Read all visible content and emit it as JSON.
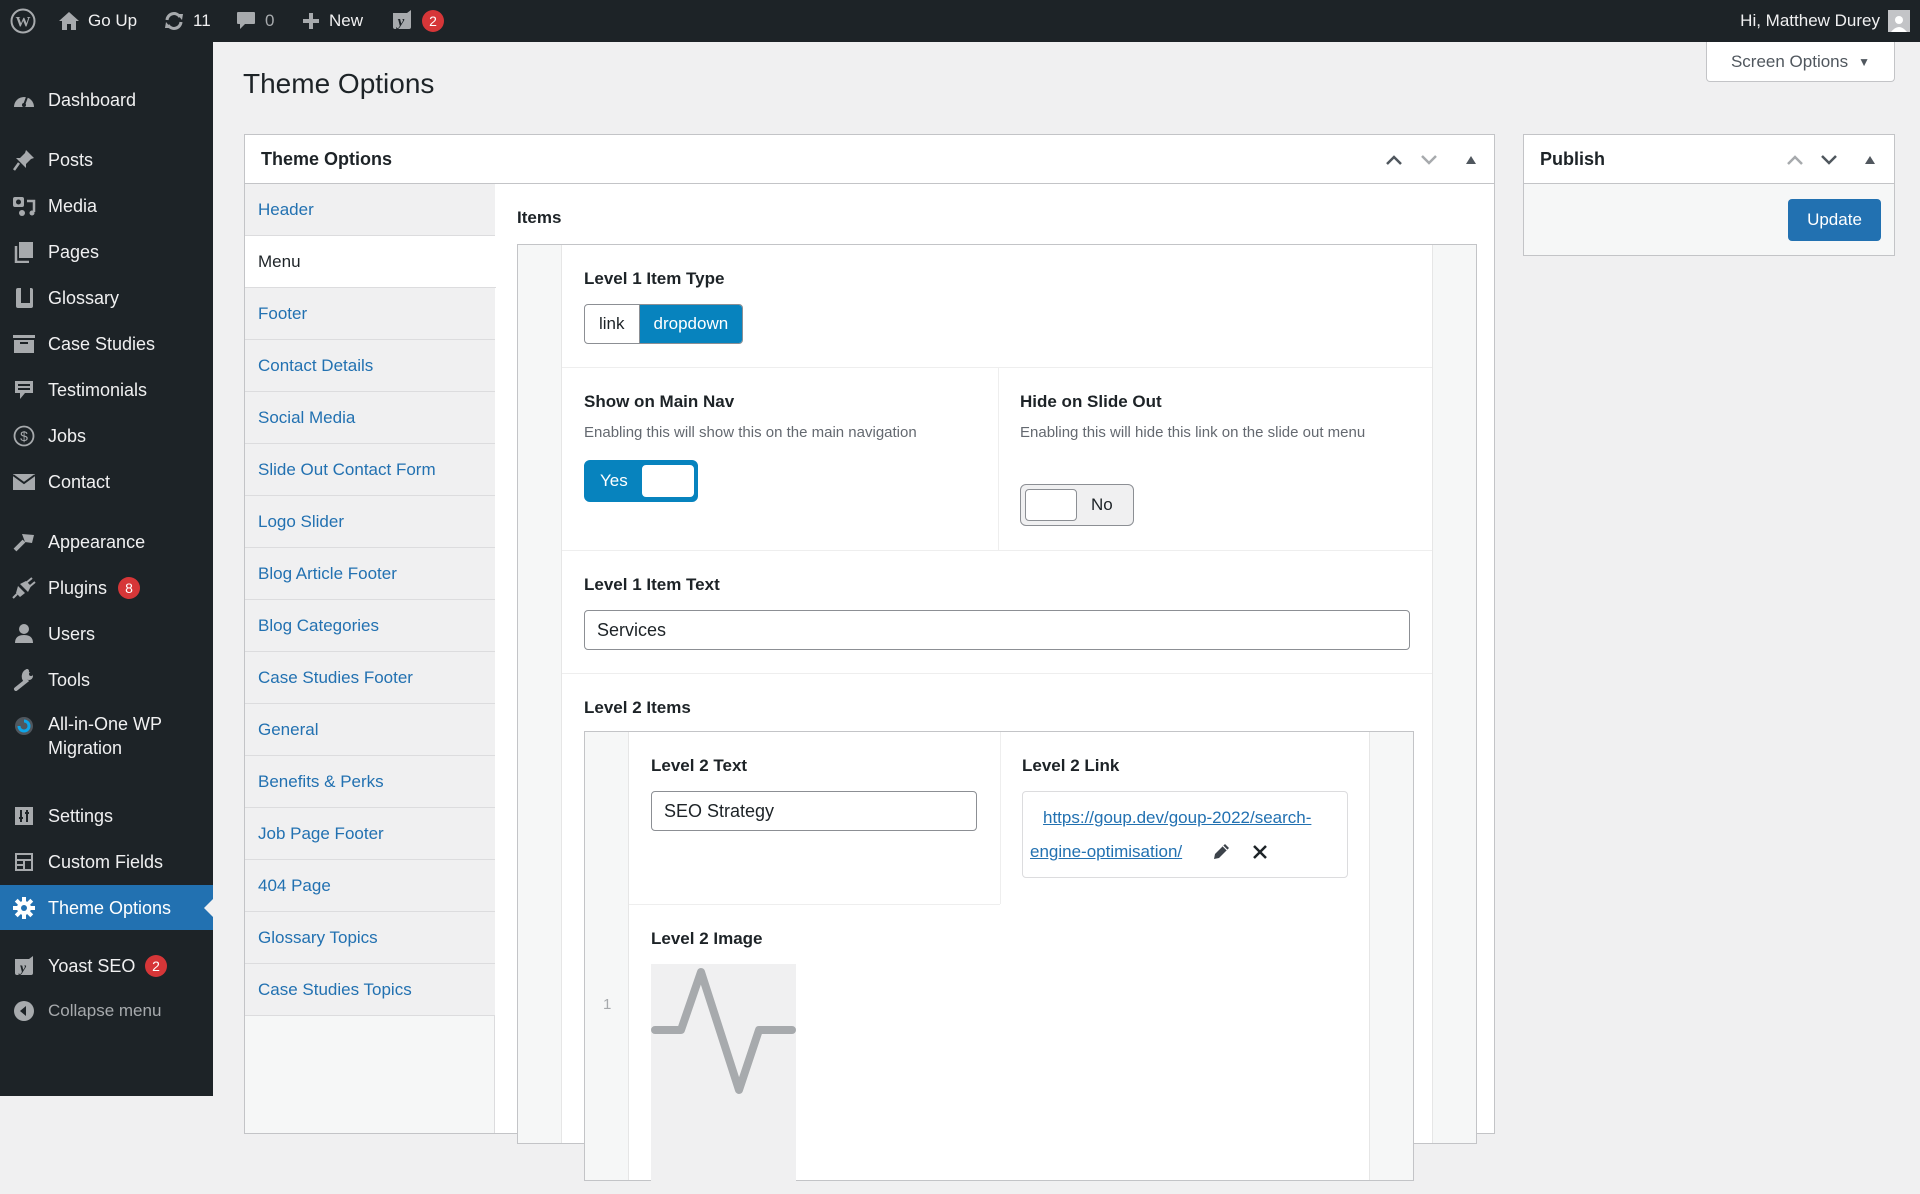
{
  "adminbar": {
    "site_name": "Go Up",
    "updates_count": "11",
    "comments_count": "0",
    "new_label": "New",
    "yoast_badge": "2",
    "greeting": "Hi, Matthew Durey"
  },
  "sidebar": {
    "items": [
      {
        "label": "Dashboard",
        "icon": "dashboard-icon"
      },
      {
        "label": "Posts",
        "icon": "pin-icon"
      },
      {
        "label": "Media",
        "icon": "media-icon"
      },
      {
        "label": "Pages",
        "icon": "pages-icon"
      },
      {
        "label": "Glossary",
        "icon": "book-icon"
      },
      {
        "label": "Case Studies",
        "icon": "archive-icon"
      },
      {
        "label": "Testimonials",
        "icon": "testimonial-icon"
      },
      {
        "label": "Jobs",
        "icon": "money-icon"
      },
      {
        "label": "Contact",
        "icon": "email-icon"
      },
      {
        "label": "Appearance",
        "icon": "brush-icon"
      },
      {
        "label": "Plugins",
        "icon": "plugin-icon",
        "badge": "8"
      },
      {
        "label": "Users",
        "icon": "user-icon"
      },
      {
        "label": "Tools",
        "icon": "wrench-icon"
      },
      {
        "label": "All-in-One WP Migration",
        "icon": "migration-icon"
      },
      {
        "label": "Settings",
        "icon": "settings-icon"
      },
      {
        "label": "Custom Fields",
        "icon": "fields-icon"
      },
      {
        "label": "Theme Options",
        "icon": "gear-icon",
        "active": true
      },
      {
        "label": "Yoast SEO",
        "icon": "yoast-icon",
        "badge": "2"
      },
      {
        "label": "Collapse menu",
        "icon": "collapse-icon"
      }
    ]
  },
  "header": {
    "page_title": "Theme Options",
    "screen_options_label": "Screen Options"
  },
  "main_box": {
    "title": "Theme Options",
    "tabs": [
      "Header",
      "Menu",
      "Footer",
      "Contact Details",
      "Social Media",
      "Slide Out Contact Form",
      "Logo Slider",
      "Blog Article Footer",
      "Blog Categories",
      "Case Studies Footer",
      "General",
      "Benefits & Perks",
      "Job Page Footer",
      "404 Page",
      "Glossary Topics",
      "Case Studies Topics"
    ],
    "active_tab": "Menu",
    "items_label": "Items",
    "level1_type": {
      "label": "Level 1 Item Type",
      "options": [
        "link",
        "dropdown"
      ],
      "selected": "dropdown"
    },
    "show_main_nav": {
      "label": "Show on Main Nav",
      "description": "Enabling this will show this on the main navigation",
      "value": "Yes"
    },
    "hide_slide_out": {
      "label": "Hide on Slide Out",
      "description": "Enabling this will hide this link on the slide out menu",
      "value": "No"
    },
    "level1_text": {
      "label": "Level 1 Item Text",
      "value": "Services"
    },
    "level2_items": {
      "label": "Level 2 Items",
      "rows": [
        {
          "row_number": "1",
          "text_label": "Level 2 Text",
          "text_value": "SEO Strategy",
          "link_label": "Level 2 Link",
          "link_url_line1": "https://goup.dev/goup-2022/search-",
          "link_url_line2": "engine-optimisation/",
          "image_label": "Level 2 Image"
        }
      ]
    }
  },
  "publish_box": {
    "title": "Publish",
    "update_label": "Update"
  },
  "colors": {
    "accent": "#2271b1",
    "toggle_on": "#0783be",
    "badge": "#d63638",
    "adminbar_bg": "#1d2327"
  }
}
